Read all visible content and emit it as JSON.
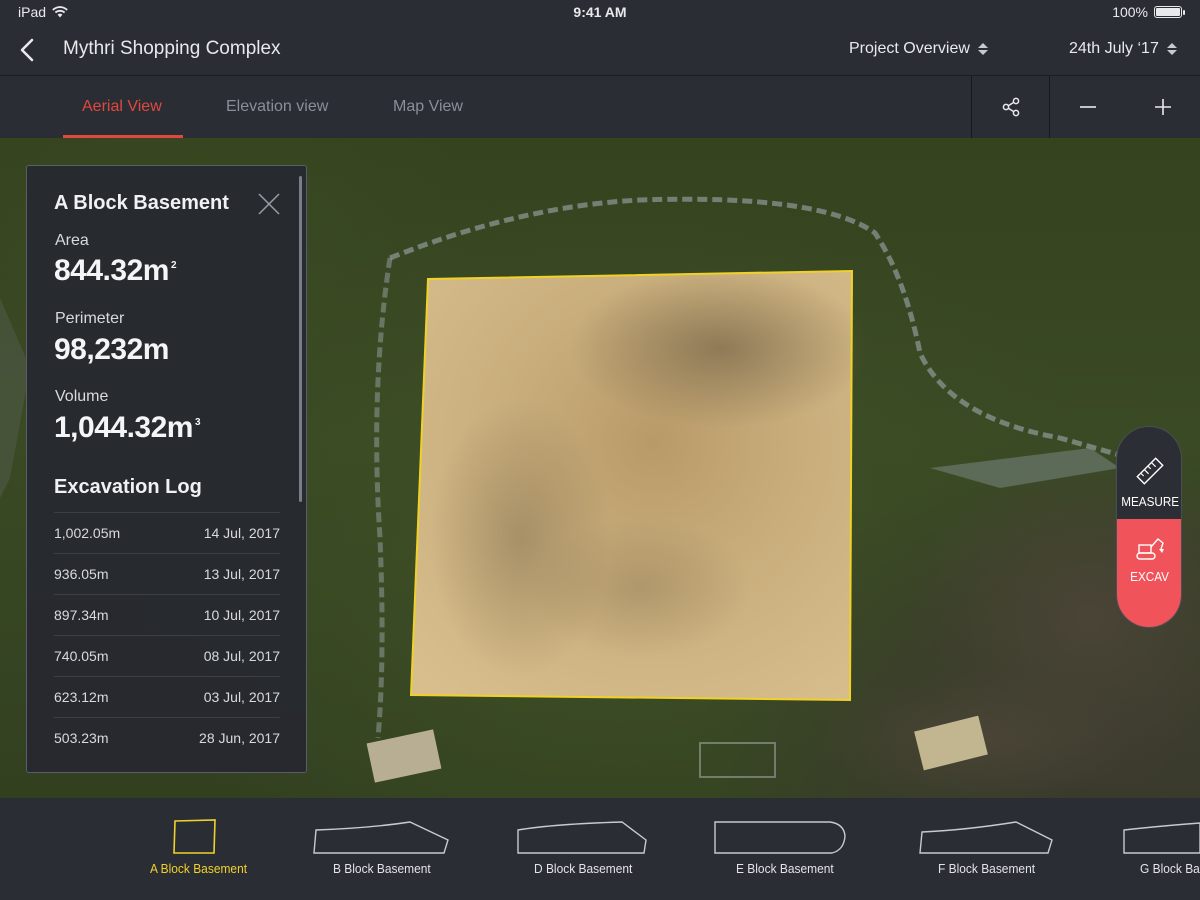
{
  "status_bar": {
    "device": "iPad",
    "time": "9:41 AM",
    "battery": "100%"
  },
  "nav": {
    "title": "Mythri Shopping Complex",
    "view_select": "Project Overview",
    "date_select": "24th July ‘17"
  },
  "tabs": [
    {
      "label": "Aerial View",
      "active": true
    },
    {
      "label": "Elevation view",
      "active": false
    },
    {
      "label": "Map View",
      "active": false
    }
  ],
  "panel": {
    "title": "A Block Basement",
    "area_label": "Area",
    "area_value": "844.32m",
    "area_unit_sup": "2",
    "perimeter_label": "Perimeter",
    "perimeter_value": "98,232m",
    "volume_label": "Volume",
    "volume_value": "1,044.32m",
    "volume_unit_sup": "3",
    "log_title": "Excavation Log",
    "log": [
      {
        "amount": "1,002.05m",
        "date": "14 Jul, 2017"
      },
      {
        "amount": "936.05m",
        "date": "13 Jul, 2017"
      },
      {
        "amount": "897.34m",
        "date": "10 Jul, 2017"
      },
      {
        "amount": "740.05m",
        "date": "08 Jul, 2017"
      },
      {
        "amount": "623.12m",
        "date": "03 Jul, 2017"
      },
      {
        "amount": "503.23m",
        "date": "28 Jun, 2017"
      }
    ]
  },
  "tools": {
    "measure_label": "MEASURE",
    "excav_label": "EXCAV"
  },
  "tray": [
    {
      "label": "A Block  Basement",
      "selected": true
    },
    {
      "label": "B Block  Basement",
      "selected": false
    },
    {
      "label": "D Block  Basement",
      "selected": false
    },
    {
      "label": "E Block  Basement",
      "selected": false
    },
    {
      "label": "F Block  Basement",
      "selected": false
    },
    {
      "label": "G Block  Bas",
      "selected": false
    }
  ],
  "colors": {
    "accent": "#e0483f",
    "selection_outline": "#f0d12a",
    "excav_button": "#f0535a",
    "chrome": "#2a2d34"
  }
}
